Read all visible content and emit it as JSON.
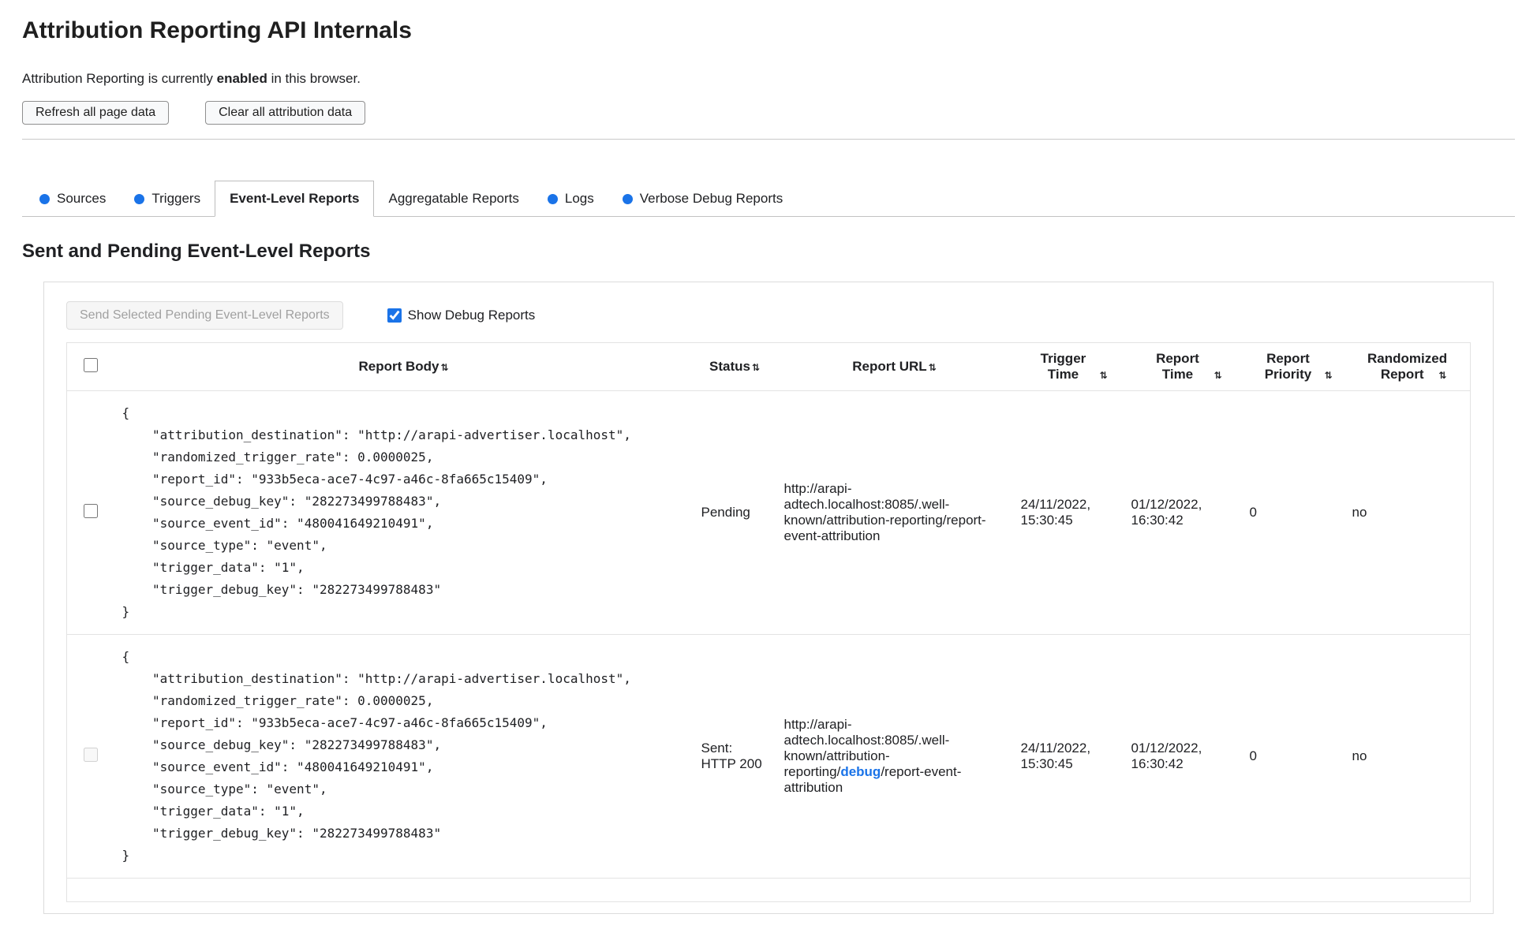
{
  "colors": {
    "accent_blue": "#1a73e8"
  },
  "page": {
    "title": "Attribution Reporting API Internals",
    "status_prefix": "Attribution Reporting is currently ",
    "status_bold": "enabled",
    "status_suffix": " in this browser."
  },
  "toolbar": {
    "refresh_label": "Refresh all page data",
    "clear_label": "Clear all attribution data"
  },
  "tabs": [
    {
      "label": "Sources"
    },
    {
      "label": "Triggers"
    },
    {
      "label": "Event-Level Reports"
    },
    {
      "label": "Aggregatable Reports"
    },
    {
      "label": "Logs"
    },
    {
      "label": "Verbose Debug Reports"
    }
  ],
  "section": {
    "heading": "Sent and Pending Event-Level Reports",
    "send_button_label": "Send Selected Pending Event-Level Reports",
    "send_button_disabled": true,
    "show_debug_label": "Show Debug Reports",
    "show_debug_checked": true
  },
  "table": {
    "sort_icon": "⇅",
    "headers": {
      "report_body": "Report Body",
      "status": "Status",
      "report_url": "Report URL",
      "trigger_time": "Trigger Time",
      "report_time": "Report Time",
      "report_priority": "Report Priority",
      "randomized_report": "Randomized Report"
    },
    "rows": [
      {
        "body": "{\n    \"attribution_destination\": \"http://arapi-advertiser.localhost\",\n    \"randomized_trigger_rate\": 0.0000025,\n    \"report_id\": \"933b5eca-ace7-4c97-a46c-8fa665c15409\",\n    \"source_debug_key\": \"282273499788483\",\n    \"source_event_id\": \"480041649210491\",\n    \"source_type\": \"event\",\n    \"trigger_data\": \"1\",\n    \"trigger_debug_key\": \"282273499788483\"\n}",
        "status": "Pending",
        "report_url": "http://arapi-adtech.localhost:8085/.well-known/attribution-reporting/report-event-attribution",
        "trigger_time": "24/11/2022, 15:30:45",
        "report_time": "01/12/2022, 16:30:42",
        "report_priority": "0",
        "randomized_report": "no"
      },
      {
        "body": "{\n    \"attribution_destination\": \"http://arapi-advertiser.localhost\",\n    \"randomized_trigger_rate\": 0.0000025,\n    \"report_id\": \"933b5eca-ace7-4c97-a46c-8fa665c15409\",\n    \"source_debug_key\": \"282273499788483\",\n    \"source_event_id\": \"480041649210491\",\n    \"source_type\": \"event\",\n    \"trigger_data\": \"1\",\n    \"trigger_debug_key\": \"282273499788483\"\n}",
        "status": "Sent: HTTP 200",
        "report_url_prefix": "http://arapi-adtech.localhost:8085/.well-known/attribution-reporting/",
        "report_url_debug": "debug",
        "report_url_suffix": "/report-event-attribution",
        "trigger_time": "24/11/2022, 15:30:45",
        "report_time": "01/12/2022, 16:30:42",
        "report_priority": "0",
        "randomized_report": "no",
        "checkbox_disabled": true
      }
    ]
  }
}
